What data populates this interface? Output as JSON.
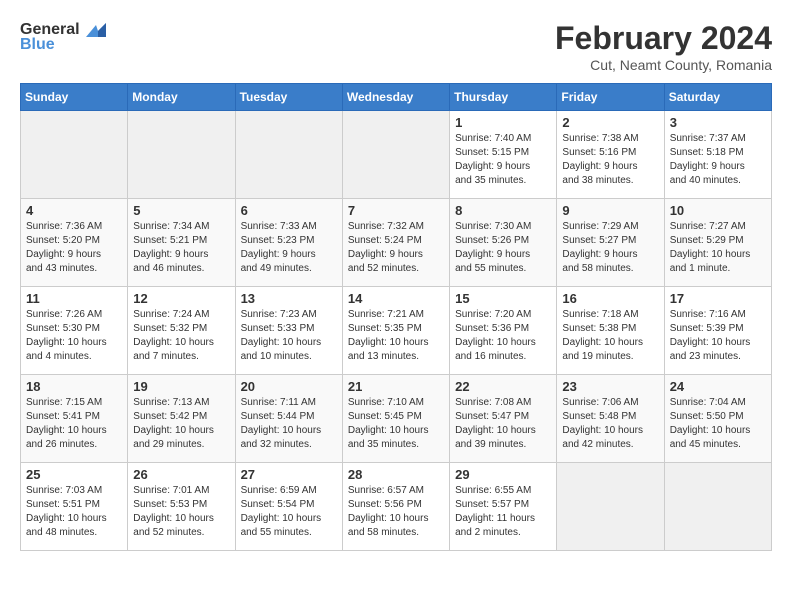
{
  "header": {
    "logo_line1": "General",
    "logo_line2": "Blue",
    "month": "February 2024",
    "location": "Cut, Neamt County, Romania"
  },
  "days_of_week": [
    "Sunday",
    "Monday",
    "Tuesday",
    "Wednesday",
    "Thursday",
    "Friday",
    "Saturday"
  ],
  "weeks": [
    [
      {
        "day": "",
        "info": ""
      },
      {
        "day": "",
        "info": ""
      },
      {
        "day": "",
        "info": ""
      },
      {
        "day": "",
        "info": ""
      },
      {
        "day": "1",
        "info": "Sunrise: 7:40 AM\nSunset: 5:15 PM\nDaylight: 9 hours\nand 35 minutes."
      },
      {
        "day": "2",
        "info": "Sunrise: 7:38 AM\nSunset: 5:16 PM\nDaylight: 9 hours\nand 38 minutes."
      },
      {
        "day": "3",
        "info": "Sunrise: 7:37 AM\nSunset: 5:18 PM\nDaylight: 9 hours\nand 40 minutes."
      }
    ],
    [
      {
        "day": "4",
        "info": "Sunrise: 7:36 AM\nSunset: 5:20 PM\nDaylight: 9 hours\nand 43 minutes."
      },
      {
        "day": "5",
        "info": "Sunrise: 7:34 AM\nSunset: 5:21 PM\nDaylight: 9 hours\nand 46 minutes."
      },
      {
        "day": "6",
        "info": "Sunrise: 7:33 AM\nSunset: 5:23 PM\nDaylight: 9 hours\nand 49 minutes."
      },
      {
        "day": "7",
        "info": "Sunrise: 7:32 AM\nSunset: 5:24 PM\nDaylight: 9 hours\nand 52 minutes."
      },
      {
        "day": "8",
        "info": "Sunrise: 7:30 AM\nSunset: 5:26 PM\nDaylight: 9 hours\nand 55 minutes."
      },
      {
        "day": "9",
        "info": "Sunrise: 7:29 AM\nSunset: 5:27 PM\nDaylight: 9 hours\nand 58 minutes."
      },
      {
        "day": "10",
        "info": "Sunrise: 7:27 AM\nSunset: 5:29 PM\nDaylight: 10 hours\nand 1 minute."
      }
    ],
    [
      {
        "day": "11",
        "info": "Sunrise: 7:26 AM\nSunset: 5:30 PM\nDaylight: 10 hours\nand 4 minutes."
      },
      {
        "day": "12",
        "info": "Sunrise: 7:24 AM\nSunset: 5:32 PM\nDaylight: 10 hours\nand 7 minutes."
      },
      {
        "day": "13",
        "info": "Sunrise: 7:23 AM\nSunset: 5:33 PM\nDaylight: 10 hours\nand 10 minutes."
      },
      {
        "day": "14",
        "info": "Sunrise: 7:21 AM\nSunset: 5:35 PM\nDaylight: 10 hours\nand 13 minutes."
      },
      {
        "day": "15",
        "info": "Sunrise: 7:20 AM\nSunset: 5:36 PM\nDaylight: 10 hours\nand 16 minutes."
      },
      {
        "day": "16",
        "info": "Sunrise: 7:18 AM\nSunset: 5:38 PM\nDaylight: 10 hours\nand 19 minutes."
      },
      {
        "day": "17",
        "info": "Sunrise: 7:16 AM\nSunset: 5:39 PM\nDaylight: 10 hours\nand 23 minutes."
      }
    ],
    [
      {
        "day": "18",
        "info": "Sunrise: 7:15 AM\nSunset: 5:41 PM\nDaylight: 10 hours\nand 26 minutes."
      },
      {
        "day": "19",
        "info": "Sunrise: 7:13 AM\nSunset: 5:42 PM\nDaylight: 10 hours\nand 29 minutes."
      },
      {
        "day": "20",
        "info": "Sunrise: 7:11 AM\nSunset: 5:44 PM\nDaylight: 10 hours\nand 32 minutes."
      },
      {
        "day": "21",
        "info": "Sunrise: 7:10 AM\nSunset: 5:45 PM\nDaylight: 10 hours\nand 35 minutes."
      },
      {
        "day": "22",
        "info": "Sunrise: 7:08 AM\nSunset: 5:47 PM\nDaylight: 10 hours\nand 39 minutes."
      },
      {
        "day": "23",
        "info": "Sunrise: 7:06 AM\nSunset: 5:48 PM\nDaylight: 10 hours\nand 42 minutes."
      },
      {
        "day": "24",
        "info": "Sunrise: 7:04 AM\nSunset: 5:50 PM\nDaylight: 10 hours\nand 45 minutes."
      }
    ],
    [
      {
        "day": "25",
        "info": "Sunrise: 7:03 AM\nSunset: 5:51 PM\nDaylight: 10 hours\nand 48 minutes."
      },
      {
        "day": "26",
        "info": "Sunrise: 7:01 AM\nSunset: 5:53 PM\nDaylight: 10 hours\nand 52 minutes."
      },
      {
        "day": "27",
        "info": "Sunrise: 6:59 AM\nSunset: 5:54 PM\nDaylight: 10 hours\nand 55 minutes."
      },
      {
        "day": "28",
        "info": "Sunrise: 6:57 AM\nSunset: 5:56 PM\nDaylight: 10 hours\nand 58 minutes."
      },
      {
        "day": "29",
        "info": "Sunrise: 6:55 AM\nSunset: 5:57 PM\nDaylight: 11 hours\nand 2 minutes."
      },
      {
        "day": "",
        "info": ""
      },
      {
        "day": "",
        "info": ""
      }
    ]
  ]
}
